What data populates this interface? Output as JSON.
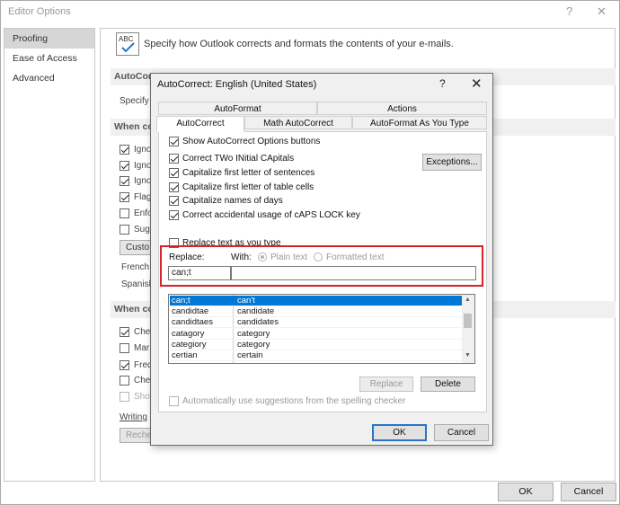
{
  "window": {
    "title": "Editor Options",
    "help_glyph": "?",
    "close_glyph": "✕",
    "ok_label": "OK",
    "cancel_label": "Cancel"
  },
  "nav": {
    "items": [
      {
        "label": "Proofing",
        "active": true
      },
      {
        "label": "Ease of Access",
        "active": false
      },
      {
        "label": "Advanced",
        "active": false
      }
    ]
  },
  "header": {
    "icon": "abc-check-icon",
    "icon_text": "ABC",
    "text": "Specify how Outlook corrects and formats the contents of your e-mails."
  },
  "background": {
    "sec1": "AutoCorre",
    "sec1_text": "Specify",
    "sec2": "When co",
    "sec2_items": [
      "Igno",
      "Igno",
      "Igno",
      "Flag",
      "Enfo",
      "Sugg"
    ],
    "custom_btn": "Custo",
    "french": "French",
    "spanish": "Spanish",
    "sec3": "When co",
    "sec3_items": [
      "Chec",
      "Mar",
      "Freq",
      "Che",
      "Show"
    ],
    "writing": "Writing",
    "recheck_btn": "Reche"
  },
  "dialog": {
    "title": "AutoCorrect: English (United States)",
    "help_glyph": "?",
    "close_glyph": "✕",
    "tabs_row1": [
      "AutoFormat",
      "Actions"
    ],
    "tabs_row2": [
      "AutoCorrect",
      "Math AutoCorrect",
      "AutoFormat As You Type"
    ],
    "show_options": "Show AutoCorrect Options buttons",
    "options": [
      "Correct TWo INitial CApitals",
      "Capitalize first letter of sentences",
      "Capitalize first letter of table cells",
      "Capitalize names of days",
      "Correct accidental usage of cAPS LOCK key"
    ],
    "exceptions_label": "Exceptions...",
    "replace_as_type": "Replace text as you type",
    "replace_label": "Replace:",
    "with_label": "With:",
    "plain_text": "Plain text",
    "formatted_text": "Formatted text",
    "replace_value": "can;t",
    "with_value": "",
    "list": [
      {
        "from": "can;t",
        "to": "can't",
        "selected": true
      },
      {
        "from": "candidtae",
        "to": "candidate",
        "selected": false
      },
      {
        "from": "candidtaes",
        "to": "candidates",
        "selected": false
      },
      {
        "from": "catagory",
        "to": "category",
        "selected": false
      },
      {
        "from": "categiory",
        "to": "category",
        "selected": false
      },
      {
        "from": "certian",
        "to": "certain",
        "selected": false
      }
    ],
    "replace_btn": "Replace",
    "delete_btn": "Delete",
    "auto_suggest": "Automatically use suggestions from the spelling checker",
    "ok_label": "OK",
    "cancel_label": "Cancel"
  },
  "colors": {
    "highlight": "#d6232a",
    "selection": "#0078d7"
  }
}
